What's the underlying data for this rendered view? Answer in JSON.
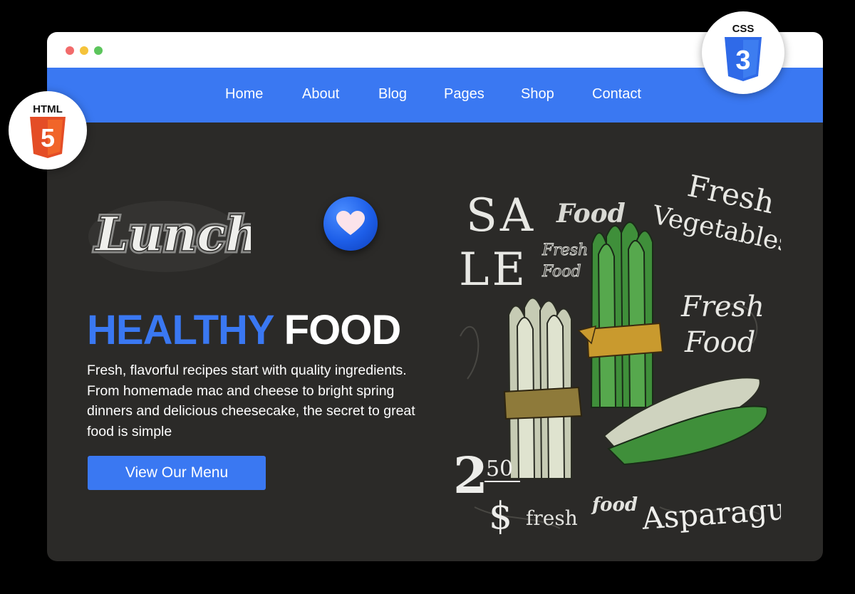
{
  "nav": {
    "items": [
      {
        "label": "Home"
      },
      {
        "label": "About"
      },
      {
        "label": "Blog"
      },
      {
        "label": "Pages"
      },
      {
        "label": "Shop"
      },
      {
        "label": "Contact"
      }
    ]
  },
  "hero": {
    "script_word": "Lunch",
    "headline_accent": "HEALTHY",
    "headline_rest": "FOOD",
    "description": "Fresh, flavorful recipes start with quality ingredients. From homemade mac and cheese to bright spring dinners and delicious cheesecake, the secret to great food is simple",
    "cta_label": "View Our Menu"
  },
  "poster": {
    "sale_line1": "SA",
    "sale_line2": "LE",
    "food_top": "Food",
    "fresh_vegetables_1": "Fresh",
    "fresh_vegetables_2": "Vegetables",
    "fresh_food_small_1": "Fresh",
    "fresh_food_small_2": "Food",
    "fresh_food_large_1": "Fresh",
    "fresh_food_large_2": "Food",
    "price_whole": "2",
    "price_cents": "50",
    "price_currency": "$",
    "fresh_bottom": "fresh",
    "food_bottom": "food",
    "asparagus": "Asparagus"
  },
  "badges": {
    "html_label": "HTML",
    "html_number": "5",
    "css_label": "CSS",
    "css_number": "3"
  },
  "colors": {
    "accent": "#3a78f2",
    "background": "#2b2a28",
    "html_orange": "#e44d26",
    "css_blue": "#2f6ae8"
  },
  "icons": [
    "heart-icon",
    "html5-logo-icon",
    "css3-logo-icon"
  ]
}
